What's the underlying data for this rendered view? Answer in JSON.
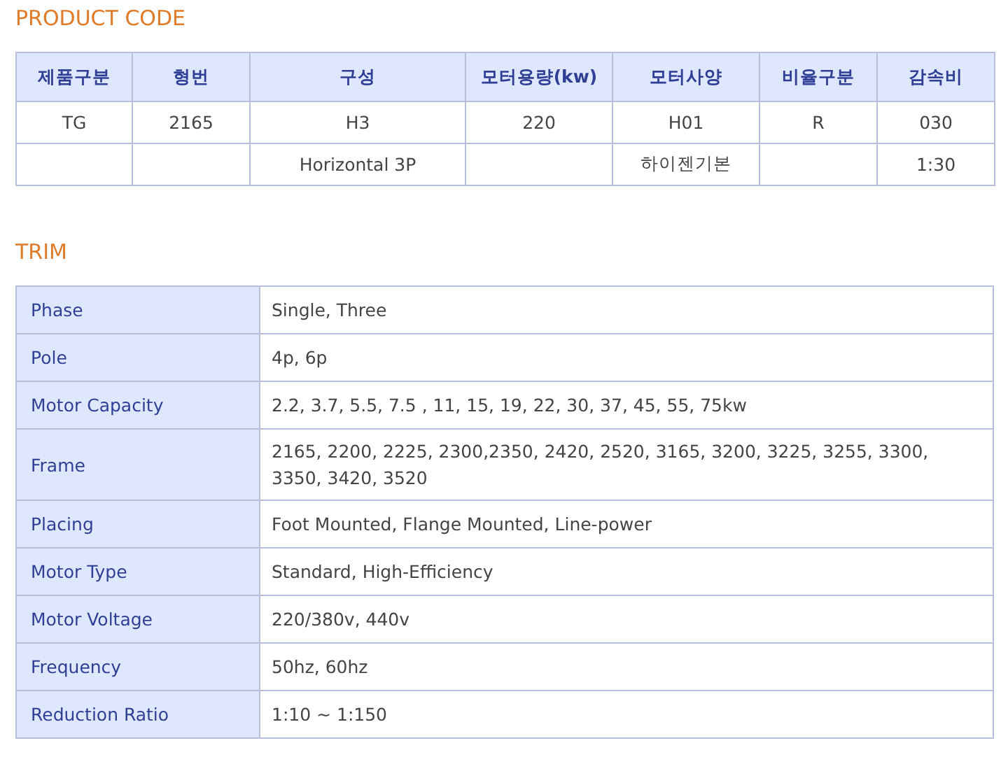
{
  "product_code": {
    "title": "PRODUCT CODE",
    "columns": [
      "제품구분",
      "형번",
      "구성",
      "모터용량(kw)",
      "모터사양",
      "비율구분",
      "감속비"
    ],
    "rows": [
      {
        "cells": [
          "TG",
          "2165",
          "H3",
          "220",
          "H01",
          "R",
          "030"
        ]
      },
      {
        "cells": [
          null,
          null,
          "Horizontal 3P",
          null,
          "하이젠기본",
          null,
          "1:30"
        ]
      }
    ]
  },
  "trim": {
    "title": "TRIM",
    "rows": [
      {
        "label": "Phase",
        "value": "Single, Three"
      },
      {
        "label": "Pole",
        "value": "4p, 6p"
      },
      {
        "label": "Motor Capacity",
        "value": "2.2, 3.7, 5.5, 7.5 , 11, 15, 19, 22, 30, 37, 45, 55, 75kw"
      },
      {
        "label": "Frame",
        "value": "2165, 2200, 2225, 2300,2350, 2420, 2520, 3165, 3200, 3225, 3255, 3300, 3350, 3420, 3520"
      },
      {
        "label": "Placing",
        "value": "Foot Mounted, Flange Mounted, Line-power"
      },
      {
        "label": "Motor Type",
        "value": "Standard, High-Efficiency"
      },
      {
        "label": "Motor Voltage",
        "value": "220/380v, 440v"
      },
      {
        "label": "Frequency",
        "value": "50hz, 60hz"
      },
      {
        "label": "Reduction Ratio",
        "value": "1:10 ~ 1:150"
      }
    ]
  }
}
